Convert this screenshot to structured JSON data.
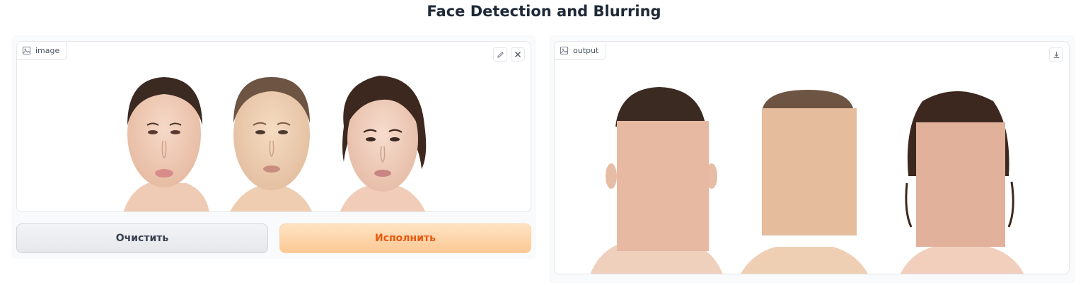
{
  "app": {
    "title": "Face Detection and Blurring"
  },
  "input": {
    "label": "image",
    "tools": {
      "edit_icon": "pencil-icon",
      "clear_icon": "close-icon"
    }
  },
  "output": {
    "label": "output",
    "tools": {
      "download_icon": "download-icon"
    }
  },
  "buttons": {
    "clear_label": "Очистить",
    "submit_label": "Исполнить"
  },
  "colors": {
    "accent": "#ea580c",
    "accent_bg": "#fdc894",
    "panel_bg": "#f9fafb",
    "border": "#e5e7eb"
  }
}
